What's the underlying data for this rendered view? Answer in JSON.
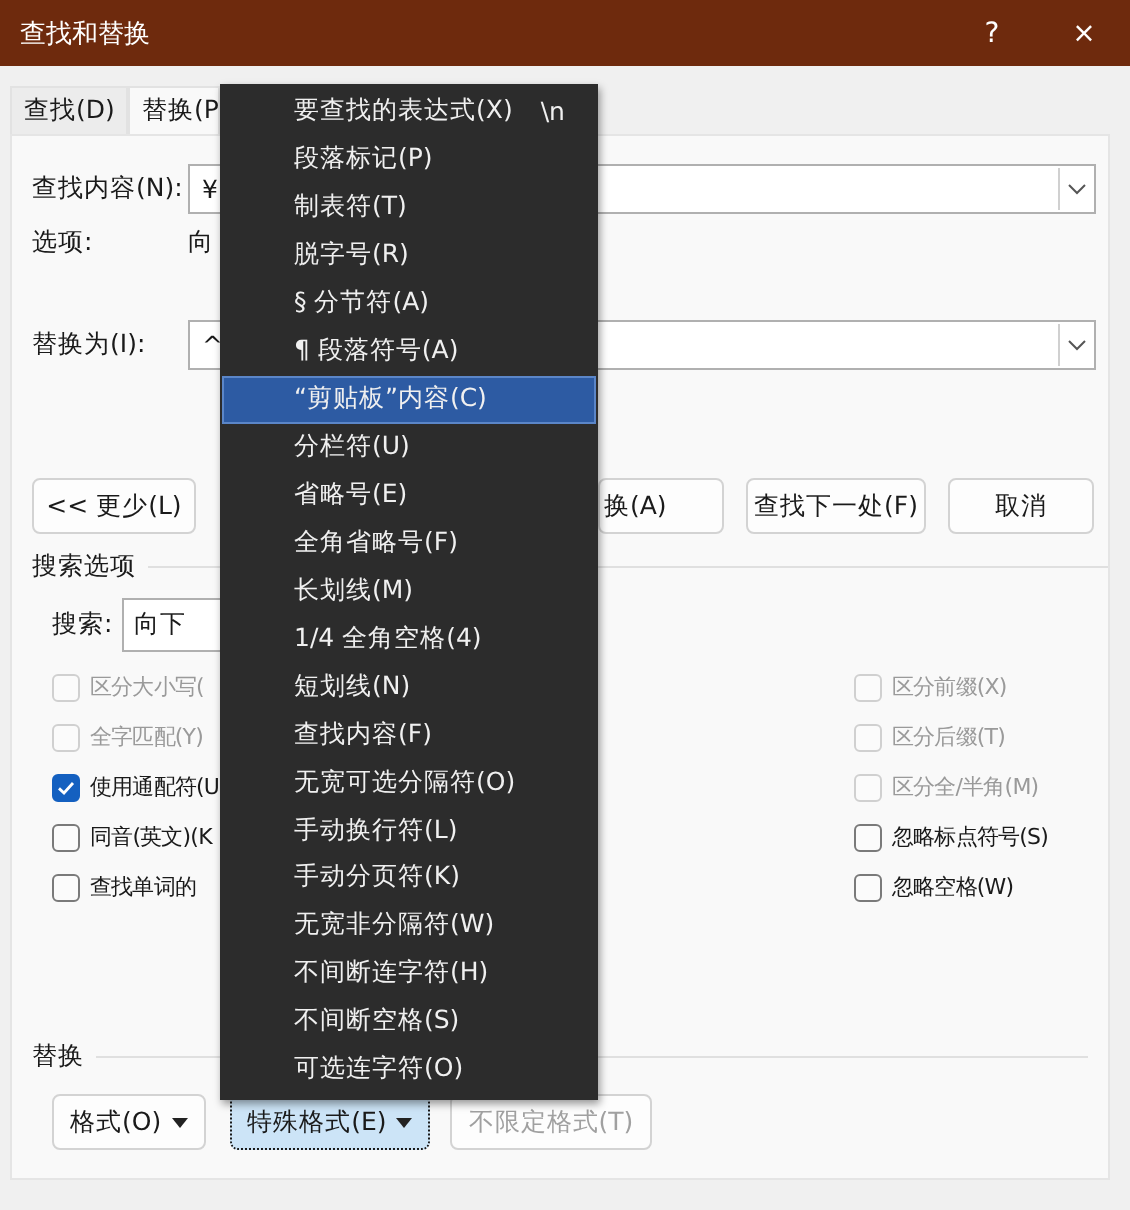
{
  "window": {
    "title": "查找和替换",
    "help": "?",
    "close": "×"
  },
  "tabs": [
    {
      "label": "查找(D)",
      "selected": false
    },
    {
      "label": "替换(P",
      "selected": true
    }
  ],
  "find": {
    "label": "查找内容(N):",
    "value": "¥"
  },
  "options": {
    "label": "选项:",
    "value": "向"
  },
  "replace": {
    "label": "替换为(I):",
    "value": "^"
  },
  "buttons": [
    {
      "label": "<< 更少(L)"
    },
    {
      "label": "换(A)"
    },
    {
      "label": "查找下一处(F)"
    },
    {
      "label": "取消"
    }
  ],
  "search_options": {
    "title": "搜索选项",
    "search_label": "搜索:",
    "search_value": "向下"
  },
  "checkboxes_left": [
    {
      "label": "区分大小写(",
      "checked": false,
      "disabled": true
    },
    {
      "label": "全字匹配(Y)",
      "checked": false,
      "disabled": true
    },
    {
      "label": "使用通配符(U",
      "checked": true,
      "disabled": false
    },
    {
      "label": "同音(英文)(K",
      "checked": false,
      "disabled": false
    },
    {
      "label": "查找单词的",
      "checked": false,
      "disabled": false
    }
  ],
  "checkboxes_right": [
    {
      "label": "区分前缀(X)",
      "checked": false,
      "disabled": true
    },
    {
      "label": "区分后缀(T)",
      "checked": false,
      "disabled": true
    },
    {
      "label": "区分全/半角(M)",
      "checked": false,
      "disabled": true
    },
    {
      "label": "忽略标点符号(S)",
      "checked": false,
      "disabled": false
    },
    {
      "label": "忽略空格(W)",
      "checked": false,
      "disabled": false
    }
  ],
  "replace_section": {
    "title": "替换",
    "buttons": [
      {
        "label": "格式(O)",
        "dropdown": true,
        "pressed": false,
        "disabled": false
      },
      {
        "label": "特殊格式(E)",
        "dropdown": true,
        "pressed": true,
        "disabled": false
      },
      {
        "label": "不限定格式(T)",
        "dropdown": false,
        "pressed": false,
        "disabled": true
      }
    ]
  },
  "menu": {
    "items": [
      {
        "label": "要查找的表达式(X)",
        "shortcut": "\\n",
        "selected": false
      },
      {
        "label": "段落标记(P)",
        "selected": false
      },
      {
        "label": "制表符(T)",
        "selected": false
      },
      {
        "label": "脱字号(R)",
        "selected": false
      },
      {
        "label": "§ 分节符(A)",
        "selected": false
      },
      {
        "label": "¶ 段落符号(A)",
        "selected": false
      },
      {
        "label": "“剪贴板”内容(C)",
        "selected": true
      },
      {
        "label": "分栏符(U)",
        "selected": false
      },
      {
        "label": "省略号(E)",
        "selected": false
      },
      {
        "label": "全角省略号(F)",
        "selected": false
      },
      {
        "label": "长划线(M)",
        "selected": false
      },
      {
        "label": "1/4 全角空格(4)",
        "selected": false
      },
      {
        "label": "短划线(N)",
        "selected": false
      },
      {
        "label": "查找内容(F)",
        "selected": false
      },
      {
        "label": "无宽可选分隔符(O)",
        "selected": false
      },
      {
        "label": "手动换行符(L)",
        "selected": false
      },
      {
        "label": "手动分页符(K)",
        "selected": false
      },
      {
        "label": "无宽非分隔符(W)",
        "selected": false
      },
      {
        "label": "不间断连字符(H)",
        "selected": false
      },
      {
        "label": "不间断空格(S)",
        "selected": false
      },
      {
        "label": "可选连字符(O)",
        "selected": false
      }
    ]
  }
}
